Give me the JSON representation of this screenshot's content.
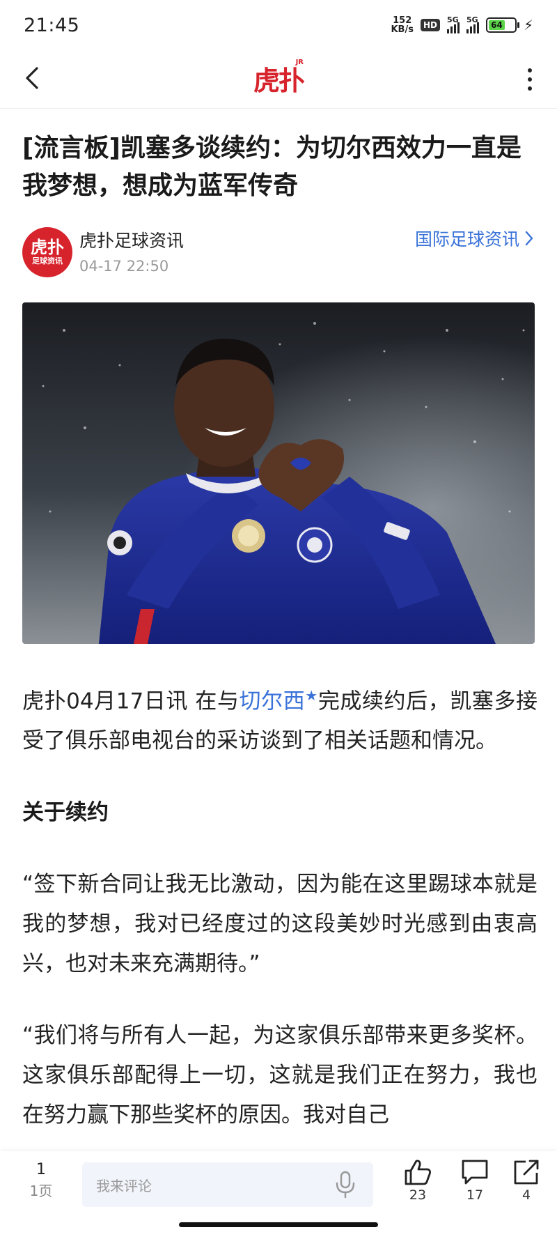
{
  "status_bar": {
    "time": "21:45",
    "net_speed_value": "152",
    "net_speed_unit": "KB/s",
    "hd_label": "HD",
    "signal_label": "5G",
    "battery_level": "64"
  },
  "nav": {
    "logo_text": "虎扑",
    "logo_badge": "JR"
  },
  "article": {
    "title": "[流言板]凯塞多谈续约：为切尔西效力一直是我梦想，想成为蓝军传奇",
    "author": {
      "avatar_main": "虎扑",
      "avatar_sub": "足球资讯",
      "name": "虎扑足球资讯",
      "time": "04-17 22:50"
    },
    "category_link": "国际足球资讯",
    "body": {
      "p1_prefix": "虎扑04月17日讯 在与",
      "p1_link": "切尔西",
      "p1_suffix": "完成续约后，凯塞多接受了俱乐部电视台的采访谈到了相关话题和情况。",
      "section_heading": "关于续约",
      "p2": "“签下新合同让我无比激动，因为能在这里踢球本就是我的梦想，我对已经度过的这段美妙时光感到由衷高兴，也对未来充满期待。”",
      "p3": "“我们将与所有人一起，为这家俱乐部带来更多奖杯。这家俱乐部配得上一切，这就是我们正在努力，我也在努力赢下那些奖杯的原因。我对自己"
    }
  },
  "bottom_bar": {
    "page_number": "1",
    "page_label": "1页",
    "comment_placeholder": "我来评论",
    "like_count": "23",
    "comment_count": "17",
    "share_count": "4"
  },
  "colors": {
    "brand_red": "#d7232c",
    "link_blue": "#3a72d8",
    "input_bg": "#f1f4fa"
  },
  "icons": {
    "back": "chevron-left-icon",
    "more": "vertical-dots-icon",
    "category_arrow": "chevron-right-icon",
    "mic": "microphone-icon",
    "like": "thumbs-up-icon",
    "comment": "speech-bubble-icon",
    "share": "share-arrow-icon",
    "verified": "star-icon"
  }
}
